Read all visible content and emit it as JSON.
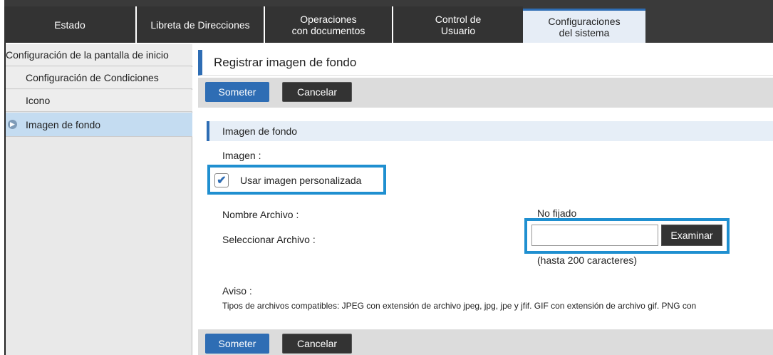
{
  "tabs": [
    {
      "label": "Estado"
    },
    {
      "label": "Libreta de Direcciones"
    },
    {
      "label": "Operaciones\ncon documentos"
    },
    {
      "label": "Control de\nUsuario"
    },
    {
      "label": "Configuraciones\ndel sistema"
    }
  ],
  "sidebar": {
    "parent": "Configuración de la pantalla de inicio",
    "items": [
      {
        "label": "Configuración de Condiciones"
      },
      {
        "label": "Icono"
      },
      {
        "label": "Imagen de fondo",
        "active": true
      }
    ]
  },
  "page": {
    "title": "Registrar imagen de fondo",
    "submit_label": "Someter",
    "cancel_label": "Cancelar",
    "section_title": "Imagen de fondo",
    "image_label": "Imagen :",
    "custom_image_checkbox": {
      "label": "Usar imagen personalizada",
      "checked": true
    },
    "file_name_label": "Nombre Archivo :",
    "file_name_value": "No fijado",
    "select_file_label": "Seleccionar Archivo :",
    "file_input_value": "",
    "browse_label": "Examinar",
    "char_limit_hint": "(hasta 200 caracteres)",
    "notice_label": "Aviso :",
    "notice_text": "Tipos de archivos compatibles: JPEG con extensión de archivo jpeg, jpg, jpe y jfif. GIF con extensión de archivo gif. PNG con"
  },
  "colors": {
    "accent": "#2e6db4",
    "highlight_border": "#1f8fd0",
    "tab_bar": "#333333",
    "active_sidebar": "#c4dcf1"
  }
}
